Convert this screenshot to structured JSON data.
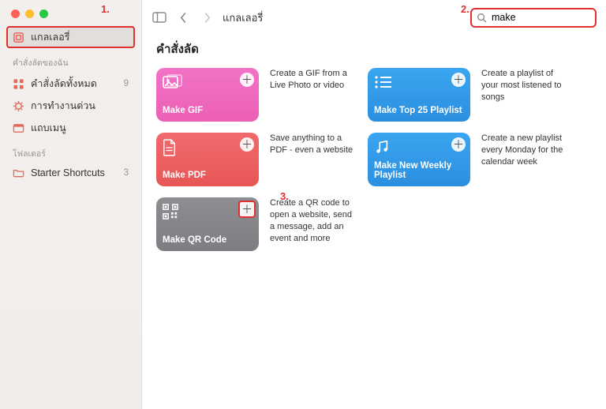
{
  "annotations": {
    "one": "1.",
    "two": "2.",
    "three": "3."
  },
  "sidebar": {
    "gallery": {
      "label": "แกลเลอรี่",
      "icon": "gallery-icon"
    },
    "section_my": "คำสั่งลัดของฉัน",
    "items": [
      {
        "label": "คำสั่งลัดทั้งหมด",
        "count": "9",
        "icon": "grid-icon"
      },
      {
        "label": "การทำงานด่วน",
        "count": "",
        "icon": "gear-icon"
      },
      {
        "label": "แถบเมนู",
        "count": "",
        "icon": "menubar-icon"
      }
    ],
    "section_folders": "โฟลเดอร์",
    "folders": [
      {
        "label": "Starter Shortcuts",
        "count": "3",
        "icon": "folder-icon"
      }
    ]
  },
  "toolbar": {
    "breadcrumb": "แกลเลอรี่",
    "search_value": "make",
    "search_placeholder": ""
  },
  "content": {
    "section_title": "คำสั่งลัด",
    "shortcuts": [
      {
        "title": "Make GIF",
        "desc": "Create a GIF from a Live Photo or video",
        "color": "c-pink",
        "icon": "image-icon"
      },
      {
        "title": "Make PDF",
        "desc": "Save anything to a PDF - even a website",
        "color": "c-red",
        "icon": "doc-icon"
      },
      {
        "title": "Make QR Code",
        "desc": "Create a QR code to open a website, send a message, add an event and more",
        "color": "c-gray",
        "icon": "qr-icon",
        "highlight_add": true
      },
      {
        "title": "Make Top 25 Playlist",
        "desc": "Create a playlist of your most listened to songs",
        "color": "c-blue",
        "icon": "list-icon"
      },
      {
        "title": "Make New Weekly Playlist",
        "desc": "Create a new playlist every Monday for the calendar week",
        "color": "c-blue2",
        "icon": "music-icon"
      }
    ]
  }
}
